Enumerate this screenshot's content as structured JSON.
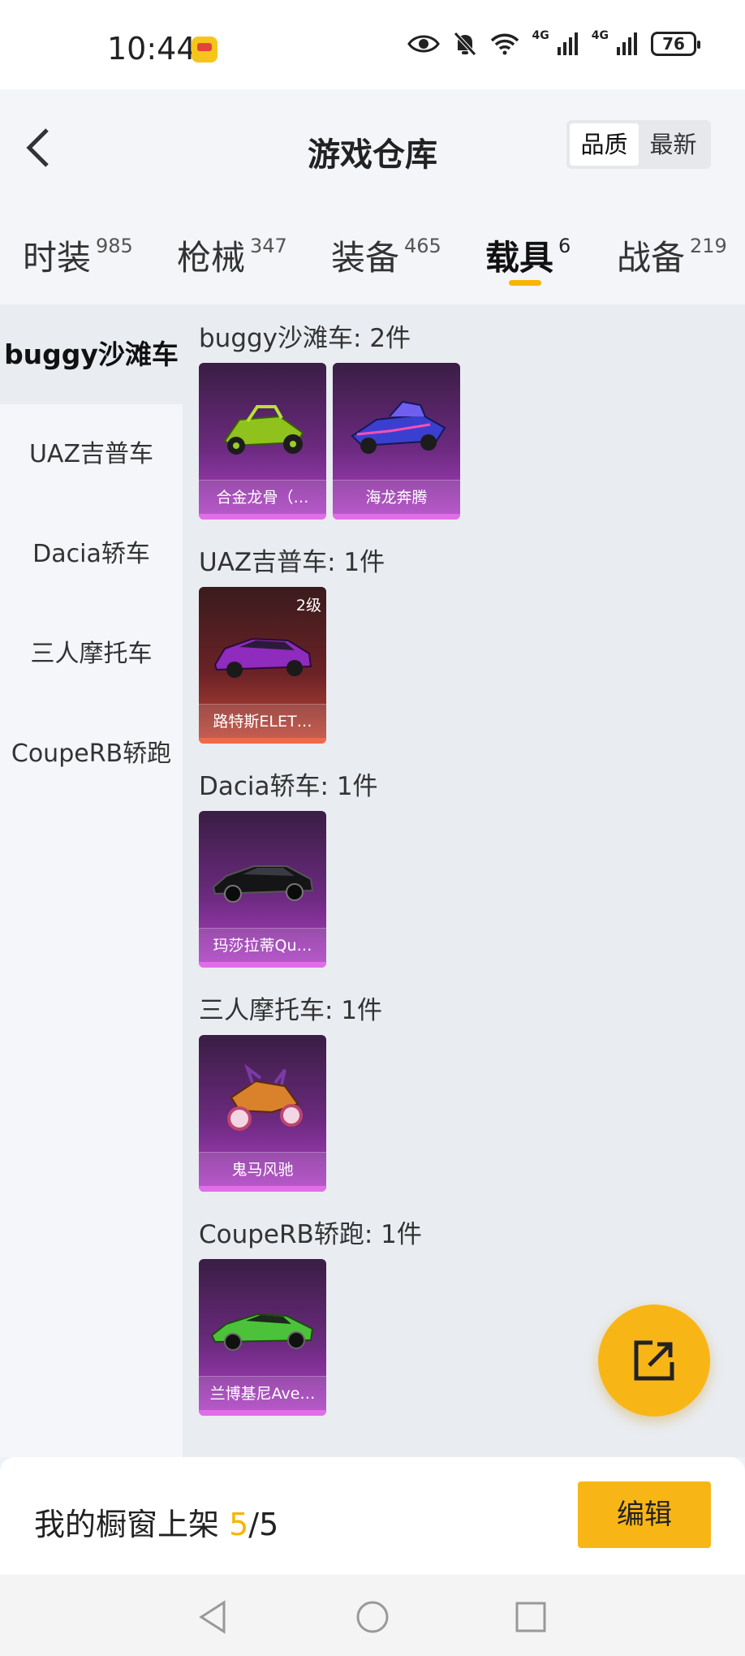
{
  "status_bar": {
    "time": "10:44",
    "battery": "76",
    "icons": [
      "eye-icon",
      "mute-bell-icon",
      "wifi-icon",
      "signal-4g-icon",
      "signal-4g-icon-2",
      "battery-icon"
    ],
    "network_label_1": "4G",
    "network_label_2": "4G"
  },
  "header": {
    "title": "游戏仓库",
    "sort_options": [
      "品质",
      "最新"
    ],
    "active_sort": "品质"
  },
  "tabs": [
    {
      "label": "时装",
      "count": "985"
    },
    {
      "label": "枪械",
      "count": "347"
    },
    {
      "label": "装备",
      "count": "465"
    },
    {
      "label": "载具",
      "count": "6"
    },
    {
      "label": "战备",
      "count": "219"
    }
  ],
  "active_tab": "载具",
  "accent_color": "#f7b500",
  "sidebar": {
    "items": [
      {
        "label": "buggy沙滩车"
      },
      {
        "label": "UAZ吉普车"
      },
      {
        "label": "Dacia轿车"
      },
      {
        "label": "三人摩托车"
      },
      {
        "label": "CoupeRB轿跑"
      }
    ],
    "active": "buggy沙滩车"
  },
  "groups": [
    {
      "title": "buggy沙滩车: 2件",
      "items": [
        {
          "name": "合金龙骨（…",
          "rarity": "purple"
        },
        {
          "name": "海龙奔腾",
          "rarity": "purple"
        }
      ]
    },
    {
      "title": "UAZ吉普车: 1件",
      "items": [
        {
          "name": "路特斯ELET…",
          "rarity": "red",
          "level": "2级"
        }
      ]
    },
    {
      "title": "Dacia轿车: 1件",
      "items": [
        {
          "name": "玛莎拉蒂Qu…",
          "rarity": "purple"
        }
      ]
    },
    {
      "title": "三人摩托车: 1件",
      "items": [
        {
          "name": "鬼马风驰",
          "rarity": "purple"
        }
      ]
    },
    {
      "title": "CoupeRB轿跑: 1件",
      "items": [
        {
          "name": "兰博基尼Ave…",
          "rarity": "purple"
        }
      ]
    }
  ],
  "bottom_bar": {
    "shelf_label": "我的橱窗上架",
    "shelf_current": "5",
    "shelf_separator": "/",
    "shelf_total": "5",
    "edit_label": "编辑"
  }
}
